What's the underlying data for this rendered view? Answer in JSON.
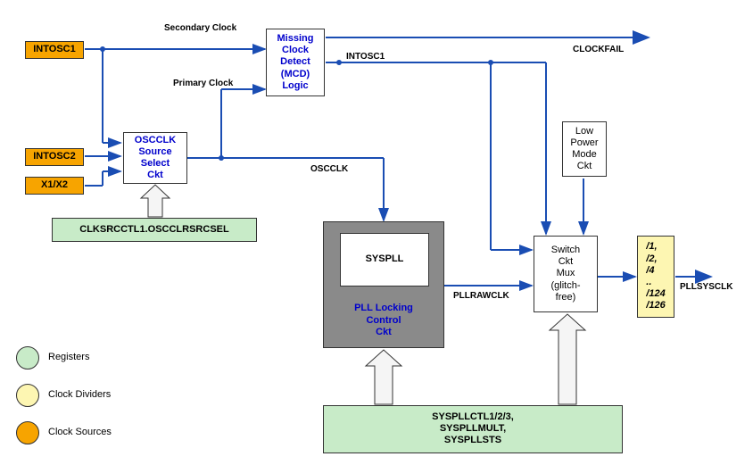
{
  "sources": {
    "intosc1": "INTOSC1",
    "intosc2": "INTOSC2",
    "x1x2": "X1/X2"
  },
  "blocks": {
    "oscclk_select": "OSCCLK\nSource\nSelect\nCkt",
    "mcd": "Missing\nClock\nDetect\n(MCD)\nLogic",
    "syspll": "SYSPLL",
    "pll_locking": "PLL Locking\nControl\nCkt",
    "switch_mux": "Switch\nCkt\nMux\n(glitch-\nfree)",
    "lpm": "Low\nPower\nMode\nCkt",
    "divider": "/1,\n/2,\n/4\n..\n/124\n/126"
  },
  "registers": {
    "clksrcctl": "CLKSRCCTL1.OSCCLRSRCSEL",
    "syspll_regs": "SYSPLLCTL1/2/3,\nSYSPLLMULT,\nSYSPLLSTS"
  },
  "signals": {
    "secondary": "Secondary Clock",
    "primary": "Primary Clock",
    "intosc1": "INTOSC1",
    "oscclk": "OSCCLK",
    "pllrawclk": "PLLRAWCLK",
    "clockfail": "CLOCKFAIL",
    "pllsysclk": "PLLSYSCLK"
  },
  "legend": {
    "registers": "Registers",
    "dividers": "Clock Dividers",
    "sources": "Clock Sources"
  }
}
